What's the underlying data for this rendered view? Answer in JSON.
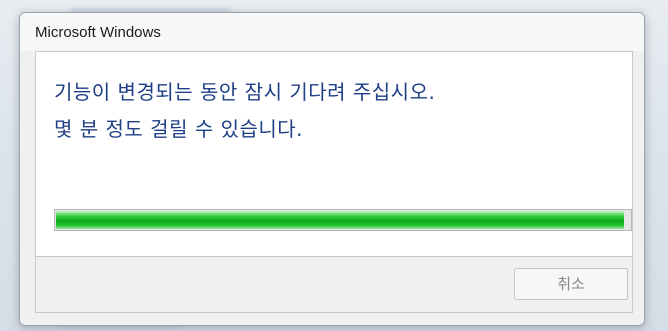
{
  "window": {
    "title": "Microsoft Windows"
  },
  "message": {
    "line1": "기능이 변경되는 동안 잠시 기다려 주십시오.",
    "line2": "몇 분 정도 걸릴 수 있습니다."
  },
  "progress": {
    "fraction": 0.99,
    "color": "#0fa61c"
  },
  "buttons": {
    "cancel_label": "취소",
    "cancel_enabled": false
  },
  "colors": {
    "message_text": "#1f3f86",
    "window_background": "#f0f0f0"
  }
}
